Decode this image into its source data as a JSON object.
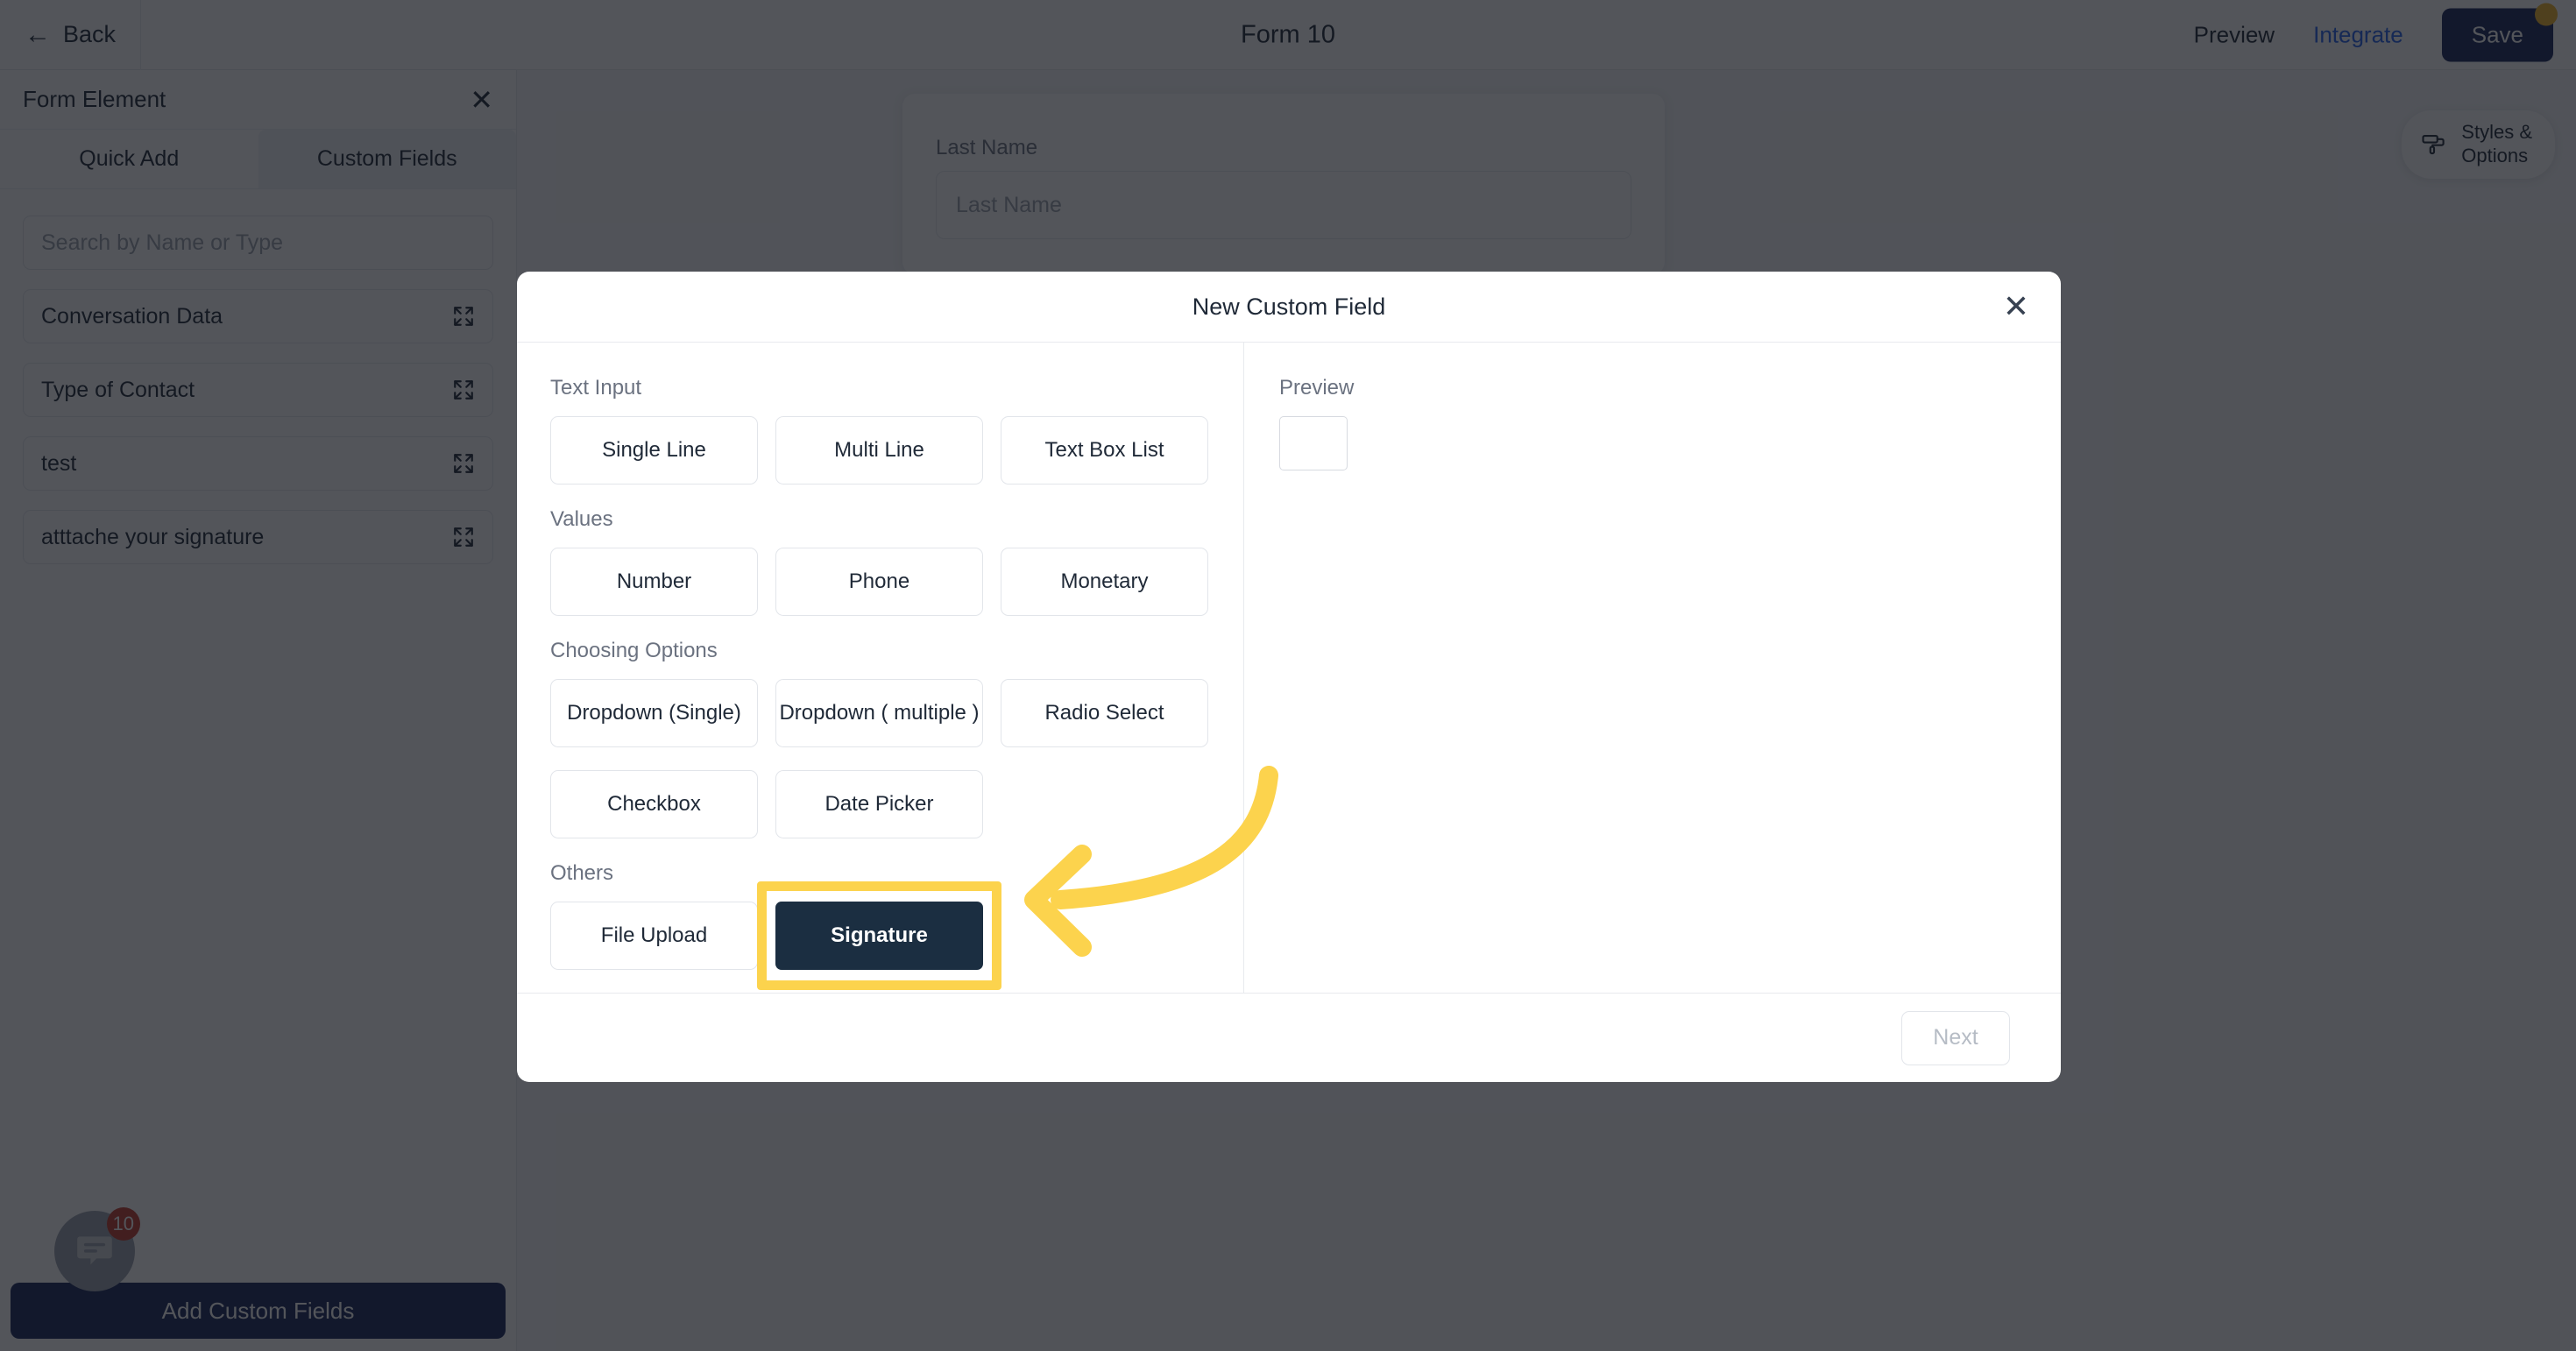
{
  "topbar": {
    "back_label": "Back",
    "back_icon": "arrow-left-icon",
    "form_title": "Form 10",
    "preview_label": "Preview",
    "integrate_label": "Integrate",
    "save_label": "Save",
    "save_badge_color": "#f0b429"
  },
  "sidebar": {
    "panel_title": "Form Element",
    "close_icon": "close-icon",
    "tabs": [
      {
        "label": "Quick Add",
        "active": false
      },
      {
        "label": "Custom Fields",
        "active": true
      }
    ],
    "search": {
      "placeholder": "Search by Name or Type",
      "value": ""
    },
    "items": [
      {
        "label": "Conversation Data",
        "icon": "expand-icon"
      },
      {
        "label": "Type of Contact",
        "icon": "expand-icon"
      },
      {
        "label": "test",
        "icon": "expand-icon"
      },
      {
        "label": "atttache your signature",
        "icon": "expand-icon"
      }
    ],
    "cta_label": "Add Custom Fields"
  },
  "chat_widget": {
    "icon": "chat-bubble-icon",
    "badge_count": "10",
    "badge_color": "#c0392b"
  },
  "canvas": {
    "styles_button": {
      "label": "Styles &\nOptions",
      "icon": "paint-roller-icon"
    },
    "form_card": {
      "field_label": "Last Name",
      "field_placeholder": "Last Name"
    }
  },
  "modal": {
    "title": "New Custom Field",
    "close_icon": "close-icon",
    "groups": [
      {
        "title": "Text Input",
        "options": [
          {
            "label": "Single Line",
            "selected": false
          },
          {
            "label": "Multi Line",
            "selected": false
          },
          {
            "label": "Text Box List",
            "selected": false
          }
        ]
      },
      {
        "title": "Values",
        "options": [
          {
            "label": "Number",
            "selected": false
          },
          {
            "label": "Phone",
            "selected": false
          },
          {
            "label": "Monetary",
            "selected": false
          }
        ]
      },
      {
        "title": "Choosing Options",
        "options": [
          {
            "label": "Dropdown (Single)",
            "selected": false
          },
          {
            "label": "Dropdown ( multiple )",
            "selected": false
          },
          {
            "label": "Radio Select",
            "selected": false
          },
          {
            "label": "Checkbox",
            "selected": false
          },
          {
            "label": "Date Picker",
            "selected": false
          }
        ]
      },
      {
        "title": "Others",
        "options": [
          {
            "label": "File Upload",
            "selected": false
          },
          {
            "label": "Signature",
            "selected": true
          }
        ]
      }
    ],
    "preview": {
      "title": "Preview"
    },
    "footer": {
      "next_label": "Next",
      "next_disabled": true
    }
  },
  "annotation": {
    "highlight_color": "#fcd34d",
    "arrow_color": "#fcd34d",
    "target": "Signature"
  }
}
